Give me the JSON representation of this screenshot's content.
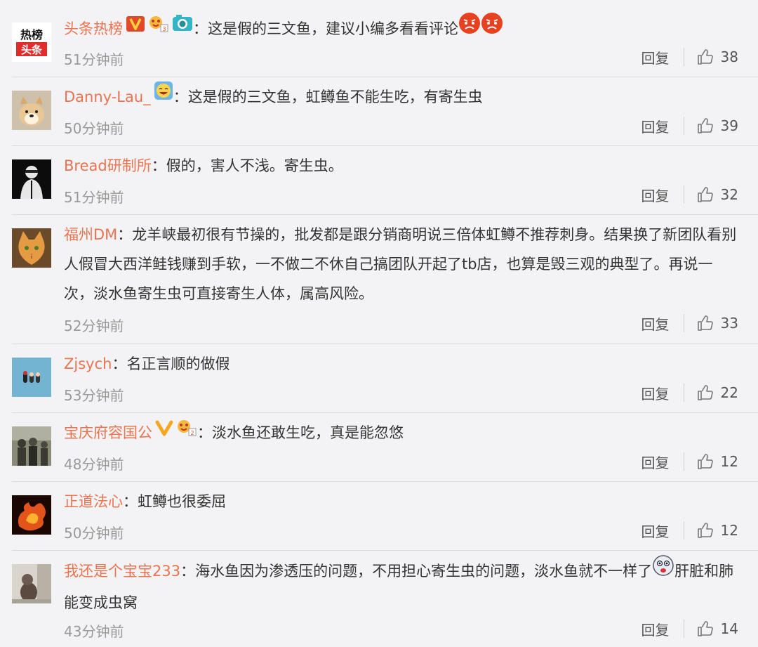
{
  "comments": [
    {
      "user": "头条热榜",
      "sep": "：",
      "text": "这是假的三文鱼，建议小编多看看评论",
      "time": "51分钟前",
      "reply": "回复",
      "likes": "38",
      "avatar": "toutiao",
      "badges": [
        "v-icon",
        "fan-icon",
        "camera-icon"
      ],
      "emoji_after": [
        "angry-emoji",
        "angry-emoji"
      ]
    },
    {
      "user": "Danny-Lau_",
      "sep": "：",
      "text": "这是假的三文鱼，虹鳟鱼不能生吃，有寄生虫",
      "time": "50分钟前",
      "reply": "回复",
      "likes": "39",
      "avatar": "dog",
      "badges": [
        "laugh-icon"
      ],
      "emoji_after": []
    },
    {
      "user": "Bread研制所",
      "sep": "：",
      "text": "假的，害人不浅。寄生虫。",
      "time": "51分钟前",
      "reply": "回复",
      "likes": "32",
      "avatar": "dark",
      "badges": [],
      "emoji_after": []
    },
    {
      "user": "福州DM",
      "sep": "：",
      "text": "龙羊峡最初很有节操的，批发都是跟分销商明说三倍体虹鳟不推荐刺身。结果换了新团队看别人假冒大西洋鲑钱赚到手软，一不做二不休自己搞团队开起了tb店，也算是毁三观的典型了。再说一次，淡水鱼寄生虫可直接寄生人体，属高风险。",
      "time": "52分钟前",
      "reply": "回复",
      "likes": "33",
      "avatar": "cat",
      "badges": [],
      "emoji_after": []
    },
    {
      "user": "Zjsych",
      "sep": "：",
      "text": "名正言顺的做假",
      "time": "53分钟前",
      "reply": "回复",
      "likes": "22",
      "avatar": "blue",
      "badges": [],
      "emoji_after": []
    },
    {
      "user": "宝庆府容国公",
      "sep": "：",
      "text": "淡水鱼还敢生吃，真是能忽悠",
      "time": "48分钟前",
      "reply": "回复",
      "likes": "12",
      "avatar": "old",
      "badges": [
        "v-gold-icon",
        "fan-icon"
      ],
      "emoji_after": []
    },
    {
      "user": "正道法心",
      "sep": "：",
      "text": "虹鳟也很委屈",
      "time": "50分钟前",
      "reply": "回复",
      "likes": "12",
      "avatar": "fire",
      "badges": [],
      "emoji_after": []
    },
    {
      "user": "我还是个宝宝233",
      "sep": "：",
      "text": "海水鱼因为渗透压的问题，不用担心寄生虫的问题，淡水鱼就不一样了",
      "text2": "肝脏和肺能变成虫窝",
      "time": "43分钟前",
      "reply": "回复",
      "likes": "14",
      "avatar": "room",
      "badges": [],
      "emoji_after": [
        "shock-emoji"
      ]
    }
  ],
  "avatar_logo": {
    "line1": "热榜",
    "line2": "头条"
  },
  "colors": {
    "username": "#eb7350",
    "text": "#333333",
    "meta": "#999999",
    "background": "#f3f3f5",
    "divider": "#dcdcdf"
  }
}
